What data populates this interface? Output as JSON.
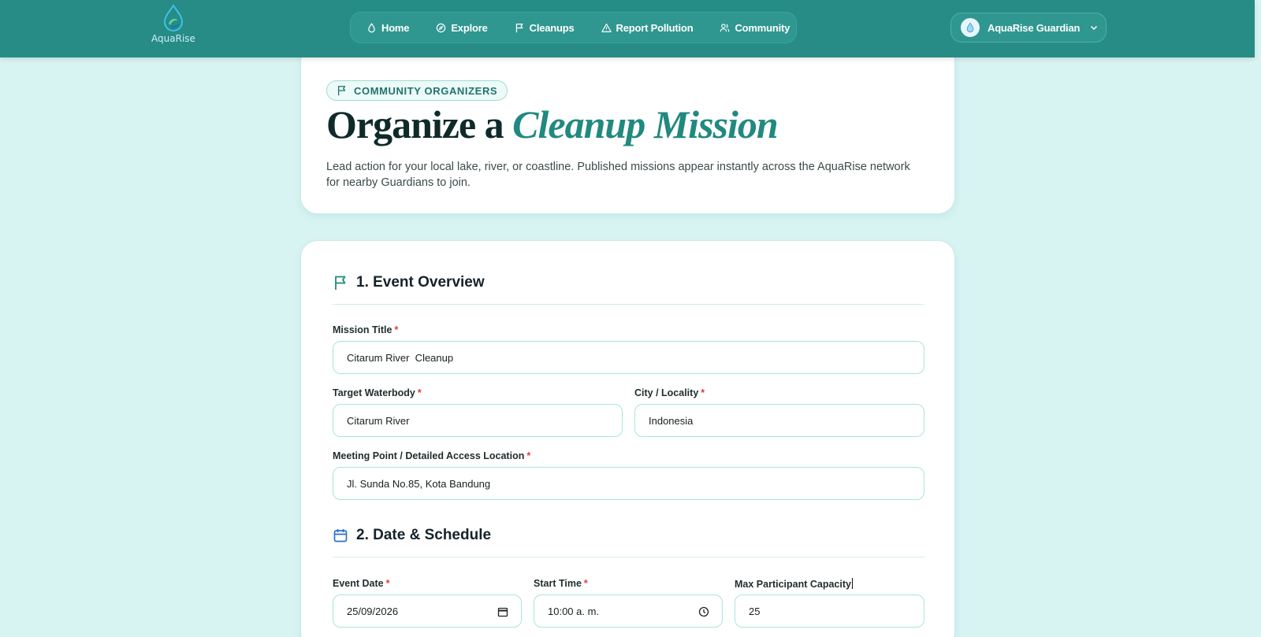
{
  "brand": {
    "name": "AquaRise"
  },
  "nav": {
    "items": [
      {
        "label": "Home",
        "icon": "droplet-icon"
      },
      {
        "label": "Explore",
        "icon": "compass-icon"
      },
      {
        "label": "Cleanups",
        "icon": "flag-icon"
      },
      {
        "label": "Report Pollution",
        "icon": "alert-triangle-icon"
      },
      {
        "label": "Community",
        "icon": "users-icon"
      }
    ]
  },
  "user": {
    "name": "AquaRise Guardian"
  },
  "hero": {
    "badge": "COMMUNITY ORGANIZERS",
    "title_plain": "Organize a",
    "title_accent": "Cleanup Mission",
    "description": "Lead action for your local lake, river, or coastline. Published missions appear instantly across the AquaRise network for nearby Guardians to join."
  },
  "form": {
    "section1": {
      "title": "1. Event Overview",
      "mission_title": {
        "label": "Mission Title",
        "value": "Citarum River  Cleanup"
      },
      "waterbody": {
        "label": "Target Waterbody",
        "value": "Citarum River"
      },
      "city": {
        "label": "City / Locality",
        "value": "Indonesia"
      },
      "meeting_point": {
        "label": "Meeting Point / Detailed Access Location",
        "value": "Jl. Sunda No.85, Kota Bandung"
      }
    },
    "section2": {
      "title": "2. Date & Schedule",
      "event_date": {
        "label": "Event Date",
        "value": "25/09/2026"
      },
      "start_time": {
        "label": "Start Time",
        "value": "10:00 a. m."
      },
      "capacity": {
        "label": "Max Participant Capacity",
        "value": "25"
      }
    },
    "required_marker": "*"
  },
  "colors": {
    "header": "#268c85",
    "accent": "#21897f",
    "background": "#d8f4f2",
    "required": "#e23b3b"
  }
}
